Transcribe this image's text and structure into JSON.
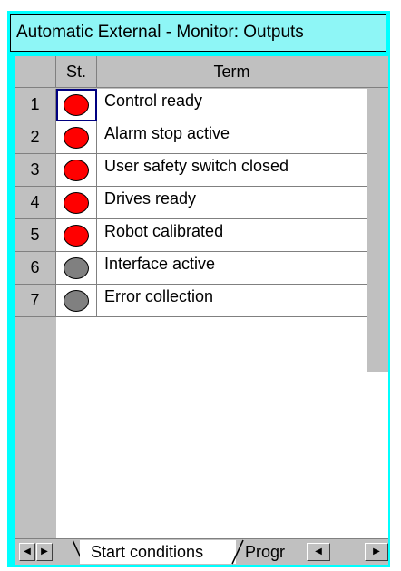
{
  "window": {
    "title": "Automatic External - Monitor: Outputs"
  },
  "table": {
    "headers": {
      "status": "St.",
      "term": "Term"
    },
    "rows": [
      {
        "num": "1",
        "status": "on",
        "term": "Control ready",
        "selected": true
      },
      {
        "num": "2",
        "status": "on",
        "term": "Alarm stop active"
      },
      {
        "num": "3",
        "status": "on",
        "term": "User safety switch closed"
      },
      {
        "num": "4",
        "status": "on",
        "term": "Drives ready"
      },
      {
        "num": "5",
        "status": "on",
        "term": "Robot calibrated"
      },
      {
        "num": "6",
        "status": "off",
        "term": "Interface active"
      },
      {
        "num": "7",
        "status": "off",
        "term": "Error collection"
      }
    ]
  },
  "tabs": [
    {
      "label": "Start conditions",
      "active": true
    },
    {
      "label": "Progr",
      "active": false
    }
  ],
  "icons": {
    "tab_scroll_left": "triangle-left-icon",
    "tab_scroll_right": "triangle-right-icon",
    "hscroll_left": "triangle-left-icon",
    "hscroll_right": "triangle-right-icon"
  },
  "colors": {
    "frame": "#00ffff",
    "titlebar": "#8ef6f6",
    "status_on": "#ff0000",
    "status_off": "#808080",
    "selection": "#000080"
  }
}
